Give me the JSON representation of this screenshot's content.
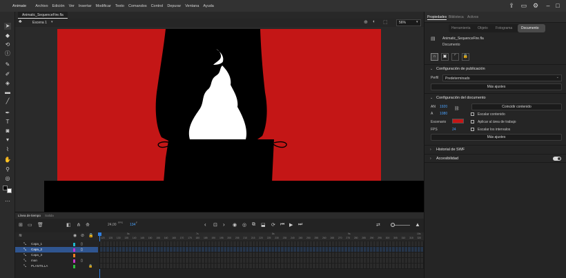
{
  "app": {
    "name": "Animate"
  },
  "menu": [
    "Archivo",
    "Edición",
    "Ver",
    "Insertar",
    "Modificar",
    "Texto",
    "Comandos",
    "Control",
    "Depurar",
    "Ventana",
    "Ayuda"
  ],
  "document_tab": "Animatic_SequenceFire.fla",
  "scene": {
    "label": "Escena 1",
    "zoom": "56%"
  },
  "panel_tabs": [
    "Propiedades",
    "Biblioteca",
    "Activos"
  ],
  "prop_tabs": [
    "Herramienta",
    "Objeto",
    "Fotograma",
    "Documento"
  ],
  "doc_info": {
    "filename": "Animatic_SequenceFire.fla",
    "type": "Documento"
  },
  "publish": {
    "title": "Configuración de publicación",
    "profile_label": "Perfil",
    "profile_value": "Predeterminado",
    "more": "Más ajustes"
  },
  "docsettings": {
    "title": "Configuración del documento",
    "an_label": "AN",
    "an_value": "1920",
    "al_label": "A",
    "al_value": "1080",
    "match_btn": "Coincidir contenido",
    "scale_content": "Escalar contenido",
    "apply_stage": "Aplicar al área de trabajo",
    "stage_label": "Escenario",
    "stage_color": "#c41616",
    "fps_label": "FPS",
    "fps_value": "24",
    "scale_intervals": "Escalar los intervalos",
    "more": "Más ajustes"
  },
  "swf_history": "Historial de SWF",
  "accessibility": "Accesibilidad",
  "timeline": {
    "tabs": [
      "Línea de tiempo",
      "Salida"
    ],
    "fps": "24,00",
    "fps_unit": "FPS",
    "frame": "134",
    "frame_unit": "F",
    "ruler": [
      "120",
      "125",
      "130",
      "135",
      "140",
      "145",
      "150",
      "155",
      "160",
      "165",
      "170",
      "175",
      "180",
      "185",
      "190",
      "195",
      "200",
      "205",
      "210",
      "215",
      "220",
      "225",
      "230",
      "235",
      "240",
      "245",
      "250",
      "255",
      "260",
      "265",
      "270",
      "275",
      "280",
      "285",
      "290",
      "295",
      "300",
      "305",
      "310",
      "315",
      "320"
    ],
    "seconds": [
      "5s",
      "7s",
      "8s",
      "9s",
      "10s"
    ],
    "layers": [
      {
        "name": "Capa_1",
        "color": "#1fb8c8"
      },
      {
        "name": "Capa_2",
        "color": "#c030d8"
      },
      {
        "name": "Capa_3",
        "color": "#f07d1e"
      },
      {
        "name": "man",
        "color": "#c838c8"
      },
      {
        "name": "PLANTILLA",
        "color": "#2fbf3f"
      }
    ]
  },
  "colors": {
    "accent": "#2f7ee0",
    "stage": "#c41616"
  }
}
